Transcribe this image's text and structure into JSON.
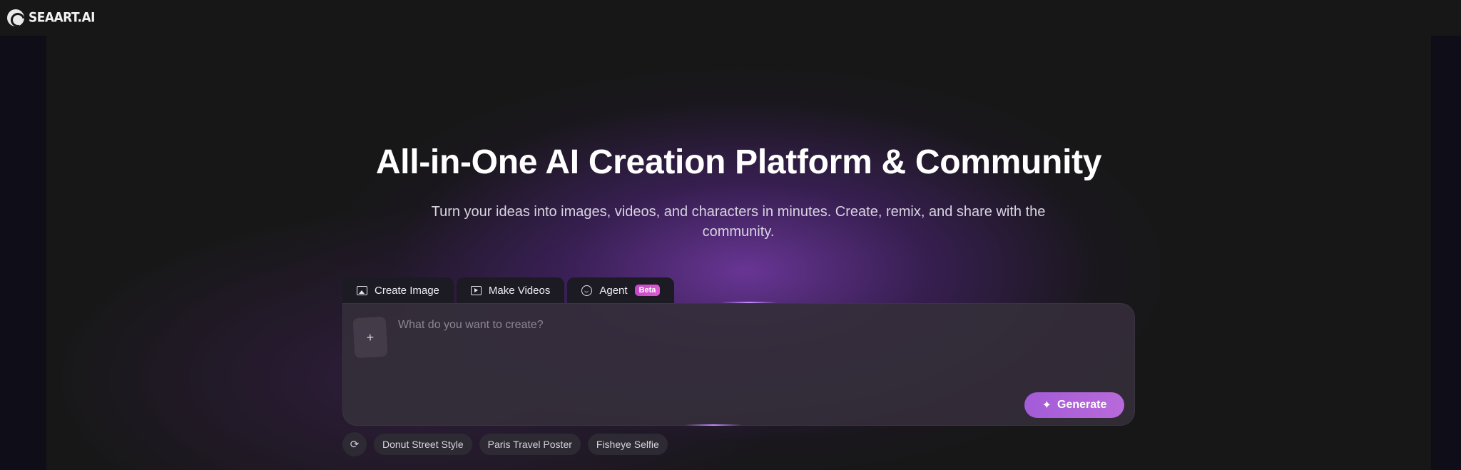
{
  "brand": {
    "logo_text": "SEAART.AI"
  },
  "hero": {
    "title": "All-in-One AI Creation Platform & Community",
    "subtitle": "Turn your ideas into images, videos, and characters in minutes. Create, remix, and share with the community."
  },
  "tabs": [
    {
      "label": "Create Image",
      "icon": "image-icon"
    },
    {
      "label": "Make Videos",
      "icon": "video-icon"
    },
    {
      "label": "Agent",
      "icon": "agent-icon",
      "badge": "Beta"
    }
  ],
  "prompt": {
    "placeholder": "What do you want to create?",
    "value": "",
    "upload_icon": "+",
    "generate_label": "Generate"
  },
  "suggestions": [
    "Donut Street Style",
    "Paris Travel Poster",
    "Fisheye Selfie"
  ],
  "colors": {
    "accent": "#a35bd8",
    "beta_badge": "#d04fcd",
    "background": "#171717"
  }
}
